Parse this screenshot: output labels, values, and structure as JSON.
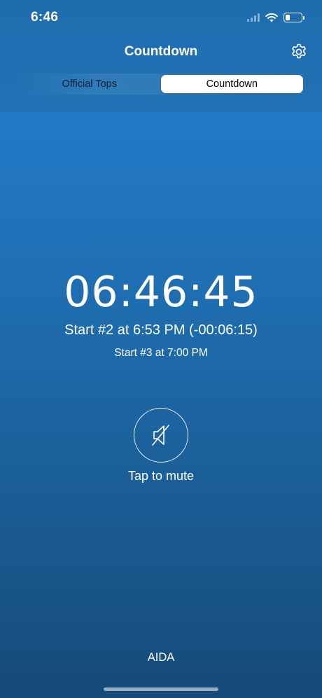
{
  "status_bar": {
    "time": "6:46",
    "battery_level": 0.3
  },
  "nav": {
    "title": "Countdown",
    "settings_icon": "gear-icon"
  },
  "segments": [
    {
      "label": "Official Tops",
      "active": false
    },
    {
      "label": "Countdown",
      "active": true
    }
  ],
  "countdown": {
    "timer": "06:46:45",
    "next_start": "Start #2 at 6:53 PM (-00:06:15)",
    "following_start": "Start #3 at 7:00 PM"
  },
  "mute": {
    "icon": "speaker-muted-icon",
    "label": "Tap to mute"
  },
  "footer": {
    "text": "AIDA"
  },
  "colors": {
    "background_top": "#2483d4",
    "background_bottom": "#154a78",
    "header": "#1f6cae"
  }
}
